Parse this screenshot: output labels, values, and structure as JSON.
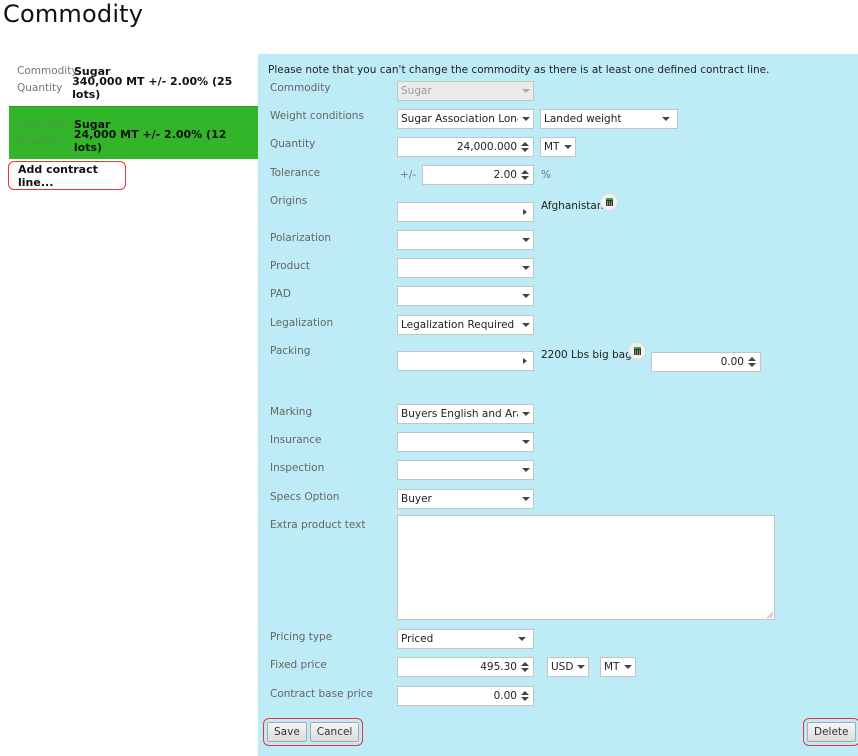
{
  "page": {
    "title": "Commodity"
  },
  "contract_lines": [
    {
      "commodity_label": "Commodity",
      "commodity": "Sugar",
      "quantity_label": "Quantity",
      "quantity": "340,000 MT +/- 2.00% (25 lots)",
      "selected": false
    },
    {
      "commodity_label": "Commodity",
      "commodity": "Sugar",
      "quantity_label": "Quantity",
      "quantity": "24,000 MT +/- 2.00% (12 lots)",
      "selected": true
    }
  ],
  "add_line_label": "Add contract line...",
  "colors": {
    "selected_bg": "#33b52a",
    "panel_bg": "#bdebf6",
    "highlight_border": "#e33333"
  },
  "form": {
    "notice": "Please note that you can't change the commodity as there is at least one defined contract line.",
    "commodity": {
      "label": "Commodity",
      "value": "Sugar",
      "disabled": true
    },
    "weight_conditions": {
      "label": "Weight conditions",
      "value": "Sugar Association Lond...",
      "second_value": "Landed weight"
    },
    "quantity": {
      "label": "Quantity",
      "value": "24,000.000",
      "unit": "MT"
    },
    "tolerance": {
      "label": "Tolerance",
      "prefix": "+/-",
      "value": "2.00",
      "suffix": "%"
    },
    "origins": {
      "label": "Origins",
      "value": "",
      "selected_item": "Afghanistan"
    },
    "polarization": {
      "label": "Polarization",
      "value": ""
    },
    "product": {
      "label": "Product",
      "value": ""
    },
    "pad": {
      "label": "PAD",
      "value": ""
    },
    "legalization": {
      "label": "Legalization",
      "value": "Legalization Required"
    },
    "packing": {
      "label": "Packing",
      "value": "",
      "selected_item": "2200 Lbs big bags",
      "item_quantity": "0.00"
    },
    "marking": {
      "label": "Marking",
      "value": "Buyers English and Ara..."
    },
    "insurance": {
      "label": "Insurance",
      "value": ""
    },
    "inspection": {
      "label": "Inspection",
      "value": ""
    },
    "specs_option": {
      "label": "Specs Option",
      "value": "Buyer"
    },
    "extra_product_text": {
      "label": "Extra product text",
      "value": ""
    },
    "pricing_type": {
      "label": "Pricing type",
      "value": "Priced"
    },
    "fixed_price": {
      "label": "Fixed price",
      "value": "495.30",
      "currency": "USD",
      "unit": "MT"
    },
    "contract_base_price": {
      "label": "Contract base price",
      "value": "0.00"
    }
  },
  "buttons": {
    "save": "Save",
    "cancel": "Cancel",
    "delete": "Delete"
  }
}
